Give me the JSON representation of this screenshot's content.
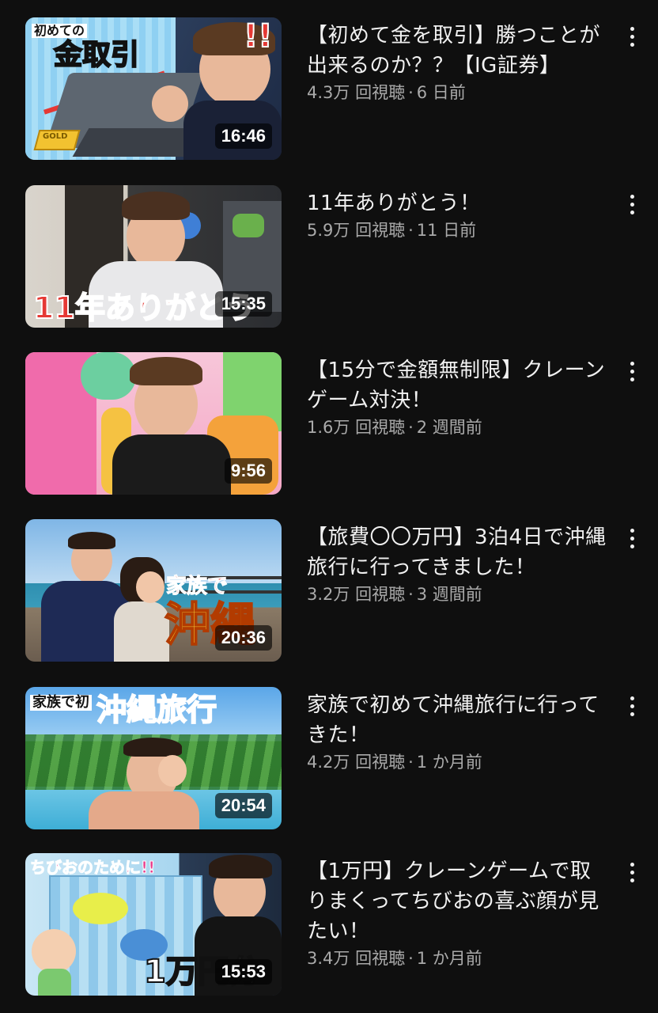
{
  "videos": [
    {
      "title": "【初めて金を取引】勝つことが出来るのか？？【IG証券】",
      "views": "4.3万 回視聴",
      "age": "6 日前",
      "duration": "16:46",
      "thumbnail_text": [
        "初めての",
        "金取引",
        "!!",
        "GOLD"
      ]
    },
    {
      "title": "11年ありがとう！",
      "views": "5.9万 回視聴",
      "age": "11 日前",
      "duration": "15:35",
      "thumbnail_text": [
        "11年ありがとう"
      ]
    },
    {
      "title": "【15分で金額無制限】クレーンゲーム対決！",
      "views": "1.6万 回視聴",
      "age": "2 週間前",
      "duration": "9:56",
      "thumbnail_text": []
    },
    {
      "title": "【旅費〇〇万円】3泊4日で沖縄旅行に行ってきました！",
      "views": "3.2万 回視聴",
      "age": "3 週間前",
      "duration": "20:36",
      "thumbnail_text": [
        "家族で",
        "沖縄"
      ]
    },
    {
      "title": "家族で初めて沖縄旅行に行ってきた！",
      "views": "4.2万 回視聴",
      "age": "1 か月前",
      "duration": "20:54",
      "thumbnail_text": [
        "家族で初",
        "沖縄旅行"
      ]
    },
    {
      "title": "【1万円】クレーンゲームで取りまくってちびおの喜ぶ顔が見たい！",
      "views": "3.4万 回視聴",
      "age": "1 か月前",
      "duration": "15:53",
      "thumbnail_text": [
        "ちびおのために!!",
        "1万円分"
      ]
    }
  ],
  "separator": "·",
  "icons": {
    "more": "more-vertical-icon"
  },
  "colors": {
    "background": "#0f0f0f",
    "title": "#f1f1f1",
    "meta": "#aaaaaa"
  }
}
